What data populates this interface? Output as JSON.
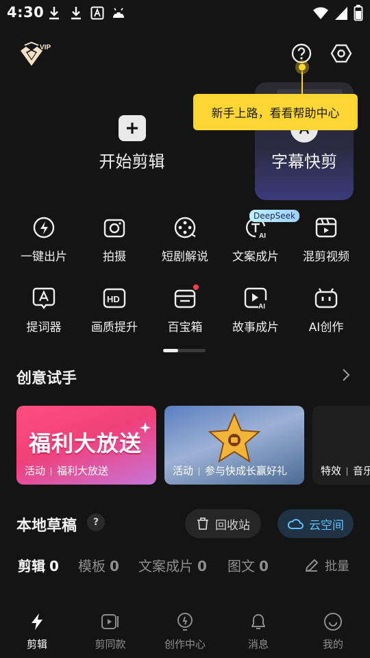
{
  "status_bar": {
    "time": "4:30",
    "left_icons": [
      "download-icon",
      "download-icon",
      "text-a-icon",
      "android-icon"
    ],
    "right_icons": [
      "wifi-icon",
      "signal-icon",
      "battery-icon"
    ]
  },
  "header": {
    "vip_label": "VIP",
    "tooltip": "新手上路，看看帮助中心"
  },
  "quick_start": {
    "start_edit_label": "开始剪辑",
    "subtitle_label": "字幕快剪"
  },
  "tools": {
    "row1": [
      "一键出片",
      "拍摄",
      "短剧解说",
      "文案成片",
      "混剪视频"
    ],
    "row2": [
      "提词器",
      "画质提升",
      "百宝箱",
      "故事成片",
      "AI创作"
    ],
    "deepseek_badge": "DeepSeek",
    "hd_text": "HD",
    "ai_text": "AI"
  },
  "creative": {
    "title": "创意试手",
    "cards": [
      {
        "art_text": "福利大放送",
        "tag": "活动",
        "caption": "福利大放送"
      },
      {
        "tag": "活动",
        "caption": "参与快成长赢好礼"
      },
      {
        "tag": "特效",
        "caption": "音乐"
      }
    ]
  },
  "drafts": {
    "title": "本地草稿",
    "help": "?",
    "recycle_label": "回收站",
    "cloud_label": "云空间",
    "tabs": [
      {
        "label": "剪辑",
        "count": "0"
      },
      {
        "label": "模板",
        "count": "0"
      },
      {
        "label": "文案成片",
        "count": "0"
      },
      {
        "label": "图文",
        "count": "0"
      }
    ],
    "batch_label": "批量"
  },
  "bottom_nav": [
    "剪辑",
    "剪同款",
    "创作中心",
    "消息",
    "我的"
  ],
  "colors": {
    "background": "#141414",
    "tooltip": "#ffd633",
    "accent_blue": "#5fc0ff",
    "notification_red": "#ff3b4e"
  }
}
